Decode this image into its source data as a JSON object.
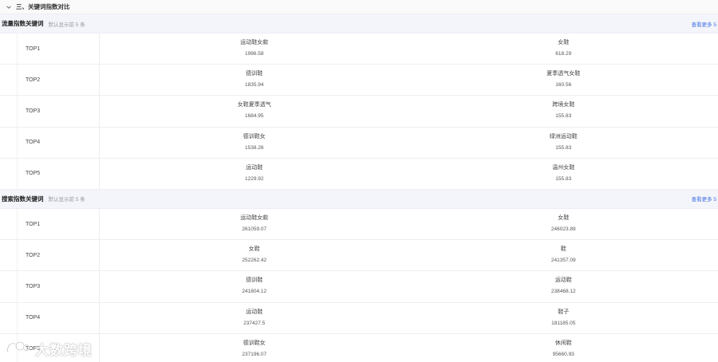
{
  "section": {
    "title": "三、关键词指数对比"
  },
  "blocks": [
    {
      "title": "流量指数关键词",
      "subtitle": "默认显示前 5 条",
      "more": "查看更多 5",
      "rows": [
        {
          "rank": "TOP1",
          "left": {
            "kw": "运动鞋女款",
            "val": "1986.58"
          },
          "right": {
            "kw": "女鞋",
            "val": "618.29"
          }
        },
        {
          "rank": "TOP2",
          "left": {
            "kw": "德训鞋",
            "val": "1835.94"
          },
          "right": {
            "kw": "夏季透气女鞋",
            "val": "160.56"
          }
        },
        {
          "rank": "TOP3",
          "left": {
            "kw": "女鞋夏季透气",
            "val": "1684.95"
          },
          "right": {
            "kw": "跨境女鞋",
            "val": "155.83"
          }
        },
        {
          "rank": "TOP4",
          "left": {
            "kw": "德训鞋女",
            "val": "1538.26"
          },
          "right": {
            "kw": "绿洲运动鞋",
            "val": "155.83"
          }
        },
        {
          "rank": "TOP5",
          "left": {
            "kw": "运动鞋",
            "val": "1229.92"
          },
          "right": {
            "kw": "温州女鞋",
            "val": "155.83"
          }
        }
      ]
    },
    {
      "title": "搜索指数关键词",
      "subtitle": "默认显示前 5 条",
      "more": "查看更多 5",
      "rows": [
        {
          "rank": "TOP1",
          "left": {
            "kw": "运动鞋女款",
            "val": "261059.07"
          },
          "right": {
            "kw": "女鞋",
            "val": "246023.89"
          }
        },
        {
          "rank": "TOP2",
          "left": {
            "kw": "女鞋",
            "val": "252262.42"
          },
          "right": {
            "kw": "鞋",
            "val": "241357.09"
          }
        },
        {
          "rank": "TOP3",
          "left": {
            "kw": "德训鞋",
            "val": "241804.12"
          },
          "right": {
            "kw": "运动鞋",
            "val": "238468.12"
          }
        },
        {
          "rank": "TOP4",
          "left": {
            "kw": "运动鞋",
            "val": "237427.5"
          },
          "right": {
            "kw": "鞋子",
            "val": "181185.05"
          }
        },
        {
          "rank": "TOP5",
          "left": {
            "kw": "德训鞋女",
            "val": "237196.07"
          },
          "right": {
            "kw": "休闲鞋",
            "val": "95660.93"
          }
        }
      ]
    }
  ],
  "watermark": {
    "text": "大数跨境",
    "icon": "watermark-logo-icon"
  }
}
